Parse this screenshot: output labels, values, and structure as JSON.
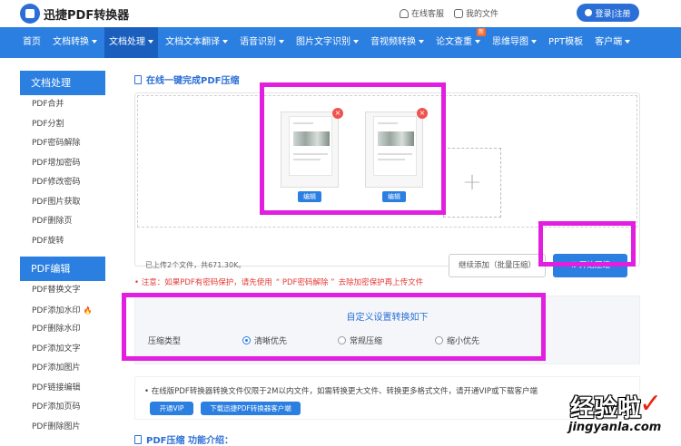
{
  "header": {
    "logo_text": "迅捷PDF转换器",
    "online_service": "在线客服",
    "my_files": "我的文件",
    "login": "登录|注册"
  },
  "nav": {
    "items": [
      {
        "label": "首页",
        "caret": false
      },
      {
        "label": "文档转换",
        "caret": true
      },
      {
        "label": "文档处理",
        "caret": true
      },
      {
        "label": "文档文本翻译",
        "caret": true
      },
      {
        "label": "语音识别",
        "caret": true
      },
      {
        "label": "图片文字识别",
        "caret": true
      },
      {
        "label": "音视频转换",
        "caret": true
      },
      {
        "label": "论文查重",
        "caret": true
      },
      {
        "label": "思维导图",
        "caret": true
      },
      {
        "label": "PPT模板",
        "caret": false
      },
      {
        "label": "客户端",
        "caret": true
      }
    ],
    "new_badge": "新"
  },
  "sidebar": {
    "group1_title": "文档处理",
    "group1_items": [
      "PDF合并",
      "PDF分割",
      "PDF密码解除",
      "PDF增加密码",
      "PDF修改密码",
      "PDF图片获取",
      "PDF删除页",
      "PDF旋转"
    ],
    "group2_title": "PDF编辑",
    "group2_items": [
      "PDF替换文字",
      "PDF添加水印",
      "PDF删除水印",
      "PDF添加文字",
      "PDF添加图片",
      "PDF链接编辑",
      "PDF添加页码",
      "PDF删除图片"
    ]
  },
  "main": {
    "title": "在线一键完成PDF压缩",
    "edit_label": "编辑",
    "close_label": "×",
    "add_label": "+",
    "uploaded_text": "已上传2个文件，共671.30K。",
    "continue_label": "继续添加（批量压缩）",
    "start_label": "开始压缩",
    "notice_prefix": "• 注意：如果PDF有密码保护，请先使用",
    "notice_link": "“ PDF密码解除 ”",
    "notice_suffix": "去除加密保护再上传文件"
  },
  "settings": {
    "title": "自定义设置转换如下",
    "type_label": "压缩类型",
    "options": [
      "清晰优先",
      "常规压缩",
      "缩小优先"
    ],
    "selected_index": 0
  },
  "vip": {
    "text": "• 在线版PDF转换器转换文件仅限于2M以内文件，如需转换更大文件、转换更多格式文件，请开通VIP或下载客户端",
    "vip_button": "开通VIP",
    "download_button": "下载迅捷PDF转换器客户端"
  },
  "footer": {
    "section_title": "PDF压缩 功能介绍："
  },
  "watermark": {
    "cn": "经验啦",
    "check": "✓",
    "url": "jingyanla.com"
  },
  "colors": {
    "accent": "#2b7fe0",
    "highlight": "#e21ee0",
    "alert": "#e53935"
  }
}
